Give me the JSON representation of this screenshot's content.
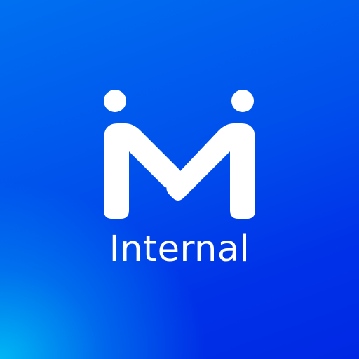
{
  "app_icon": {
    "wordmark": "Internal",
    "logo_icon_name": "m-people-logo-icon",
    "colors": {
      "background_primary": "#0050ec",
      "background_accent": "#00bef5",
      "foreground": "#ffffff"
    }
  }
}
